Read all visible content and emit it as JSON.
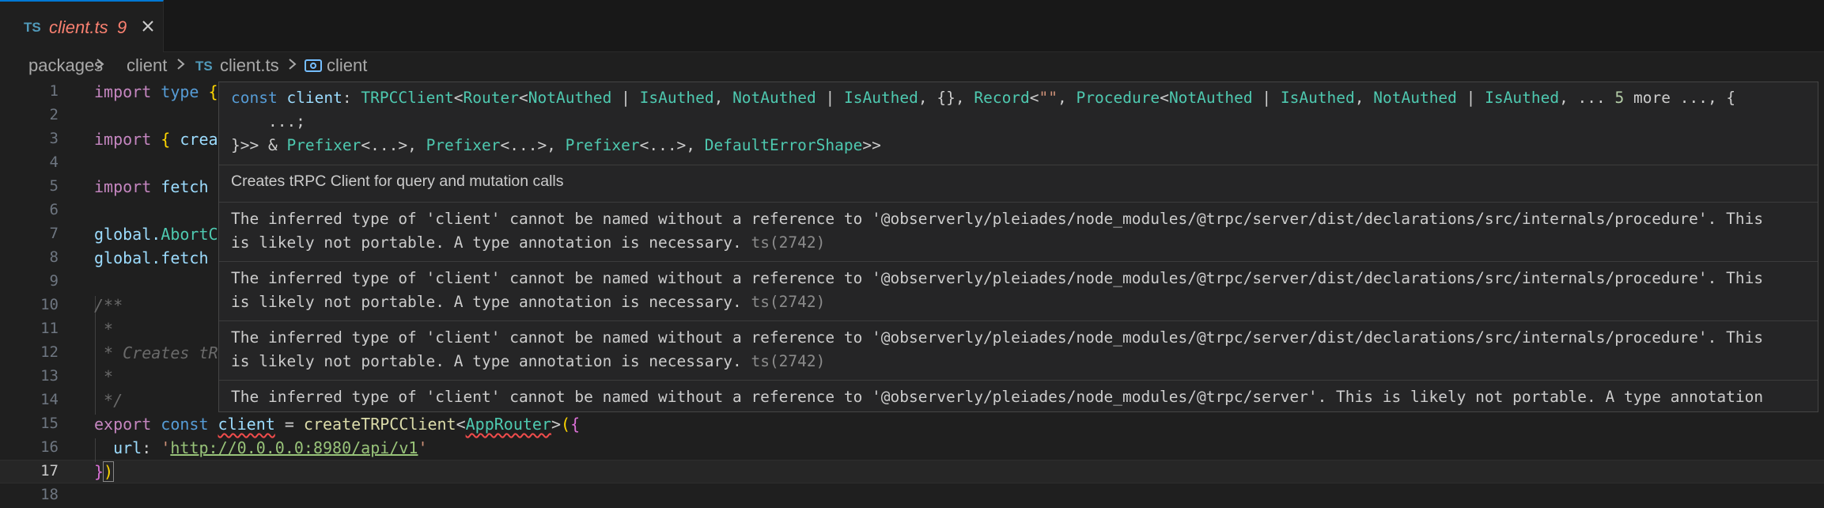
{
  "tab": {
    "lang_badge": "TS",
    "title": "client.ts",
    "problem_count": "9",
    "close_icon": "close-icon"
  },
  "breadcrumb": {
    "part1": "packages",
    "part2": "client",
    "file_badge": "TS",
    "file": "client.ts",
    "symbol_icon": "symbol-variable-icon",
    "symbol": "client"
  },
  "gutter": [
    "1",
    "2",
    "3",
    "4",
    "5",
    "6",
    "7",
    "8",
    "9",
    "10",
    "11",
    "12",
    "13",
    "14",
    "15",
    "16",
    "17",
    "18"
  ],
  "active_line": "17",
  "code": {
    "l1_a": "import",
    "l1_b": " type ",
    "l1_c": "{",
    "l3_a": "import",
    "l3_b": " { ",
    "l3_c": "crea",
    "l5_a": "import",
    "l5_b": " fetch",
    "l7_a": "global.",
    "l7_b": "AbortC",
    "l8_a": "global.",
    "l8_b": "fetch",
    "l10": "/**",
    "l11": " *",
    "l12": " * Creates tR",
    "l13": " *",
    "l14": " */",
    "l15_a": "export",
    "l15_b": " const ",
    "l15_c": "client",
    "l15_d": " = ",
    "l15_e": "createTRPCClient",
    "l15_f": "<",
    "l15_g": "AppRouter",
    "l15_h": ">",
    "l15_i": "(",
    "l15_j": "{",
    "l16_a": "  url",
    "l16_b": ": ",
    "l16_c": "'",
    "l16_d": "http://0.0.0.0:8980/api/v1",
    "l16_e": "'",
    "l17_a": "}",
    "l17_b": ")"
  },
  "hover": {
    "sig1": {
      "kw": "const ",
      "name": "client",
      "colon": ": ",
      "t1": "TRPCClient",
      "p1": "<",
      "t2": "Router",
      "p2": "<",
      "t3": "NotAuthed",
      "p3": " | ",
      "t4": "IsAuthed",
      "p4": ", ",
      "t5": "NotAuthed",
      "p5": " | ",
      "t6": "IsAuthed",
      "p6": ", {}, ",
      "t7": "Record",
      "p7": "<",
      "s1": "\"\"",
      "p8": ", ",
      "t8": "Procedure",
      "p9": "<",
      "t9": "NotAuthed",
      "p10": " | ",
      "t10": "IsAuthed",
      "p11": ", ",
      "t11": "NotAuthed",
      "p12": " | ",
      "t12": "IsAuthed",
      "p13": ", ... ",
      "n1": "5",
      "p14": " more ..., {"
    },
    "sig2": "    ...;",
    "sig3": {
      "a": "}>> & ",
      "t1": "Prefixer",
      "b": "<...>, ",
      "t2": "Prefixer",
      "c": "<...>, ",
      "t3": "Prefixer",
      "d": "<...>, ",
      "t4": "DefaultErrorShape",
      "e": ">>"
    },
    "doc": "Creates tRPC Client for query and mutation calls",
    "diagnostics": [
      {
        "line1": "The inferred type of 'client' cannot be named without a reference to '@observerly/pleiades/node_modules/@trpc/server/dist/declarations/src/internals/procedure'. This",
        "line2": "is likely not portable. A type annotation is necessary. ",
        "code": "ts(2742)"
      },
      {
        "line1": "The inferred type of 'client' cannot be named without a reference to '@observerly/pleiades/node_modules/@trpc/server/dist/declarations/src/internals/procedure'. This",
        "line2": "is likely not portable. A type annotation is necessary. ",
        "code": "ts(2742)"
      },
      {
        "line1": "The inferred type of 'client' cannot be named without a reference to '@observerly/pleiades/node_modules/@trpc/server/dist/declarations/src/internals/procedure'. This",
        "line2": "is likely not portable. A type annotation is necessary. ",
        "code": "ts(2742)"
      },
      {
        "line1": "The inferred type of 'client' cannot be named without a reference to '@observerly/pleiades/node_modules/@trpc/server'. This is likely not portable. A type annotation",
        "line2": "",
        "code": ""
      }
    ]
  },
  "colors": {
    "accent": "#0078d4",
    "error": "#f14c4c",
    "tab_title": "#f88070"
  }
}
